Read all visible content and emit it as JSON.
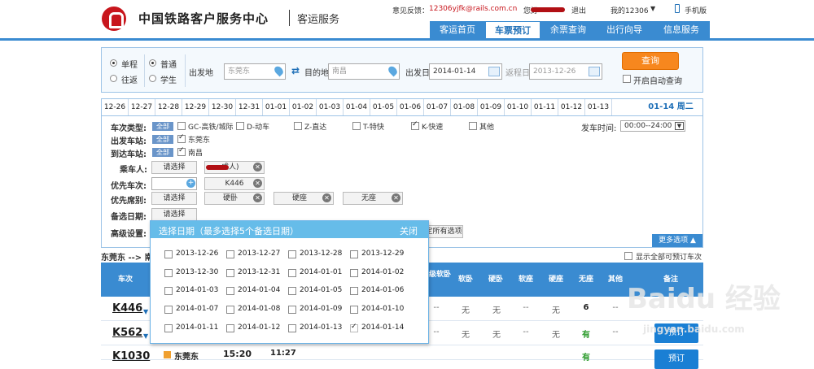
{
  "header": {
    "site_title": "中国铁路客户服务中心",
    "site_subtitle": "客运服务",
    "feedback_label": "意见反馈：",
    "feedback_email": "12306yjfk@rails.com.cn",
    "greeting": "您好",
    "logout": "退出",
    "my12306": "我的12306",
    "mobile": "手机版"
  },
  "nav": {
    "items": [
      "客运首页",
      "车票预订",
      "余票查询",
      "出行向导",
      "信息服务"
    ],
    "active_index": 1
  },
  "search": {
    "trip_oneway": "单程",
    "trip_return": "往返",
    "type_normal": "普通",
    "type_student": "学生",
    "from_label": "出发地",
    "from_value": "东莞东",
    "to_label": "目的地",
    "to_value": "南昌",
    "date_label": "出发日",
    "date_value": "2014-01-14",
    "return_label": "返程日",
    "return_value": "2013-12-26",
    "query_button": "查询",
    "auto_query": "开启自动查询"
  },
  "date_tabs": [
    "12-26",
    "12-27",
    "12-28",
    "12-29",
    "12-30",
    "12-31",
    "01-01",
    "01-02",
    "01-03",
    "01-04",
    "01-05",
    "01-06",
    "01-07",
    "01-08",
    "01-09",
    "01-10",
    "01-11",
    "01-12",
    "01-13"
  ],
  "date_current": "01-14 周二",
  "filters": {
    "train_type_label": "车次类型:",
    "all": "全部",
    "types": [
      {
        "label": "GC-高铁/城际",
        "checked": false
      },
      {
        "label": "D-动车",
        "checked": false
      },
      {
        "label": "Z-直达",
        "checked": false
      },
      {
        "label": "T-特快",
        "checked": false
      },
      {
        "label": "K-快速",
        "checked": true
      },
      {
        "label": "其他",
        "checked": false
      }
    ],
    "depart_time_label": "发车时间:",
    "depart_time_value": "00:00--24:00",
    "from_station_label": "出发车站:",
    "from_station": "东莞东",
    "to_station_label": "到达车站:",
    "to_station": "南昌",
    "passenger_label": "乘车人:",
    "select_button": "请选择",
    "passenger_value": "成人)",
    "prefer_train_label": "优先车次:",
    "prefer_train_value": "K446",
    "prefer_seat_label": "优先席别:",
    "seats": [
      "硬卧",
      "硬座",
      "无座"
    ],
    "backup_date_label": "备选日期:",
    "advanced_label": "高级设置:",
    "all_options_fragment": "定所有选项",
    "more_options": "更多选项"
  },
  "route": {
    "text": "东莞东 --> 南",
    "show_all_label": "显示全部可预订车次"
  },
  "table": {
    "headers": [
      "车次",
      "高级软卧",
      "软卧",
      "硬卧",
      "软座",
      "硬座",
      "无座",
      "其他",
      "备注"
    ],
    "rows": [
      {
        "train": "K446",
        "cells": [
          "--",
          "无",
          "无",
          "--",
          "无",
          "6",
          "--"
        ],
        "book": "预订"
      },
      {
        "train": "K562",
        "cells": [
          "--",
          "无",
          "无",
          "--",
          "无",
          "有",
          "--"
        ],
        "book": "预订"
      },
      {
        "train": "K1030",
        "station": "东莞东",
        "depart": "15:20",
        "arrive": "11:27",
        "cells": [
          "--",
          "--",
          "--",
          "--",
          "--",
          "有",
          "--"
        ],
        "book": "预订"
      }
    ]
  },
  "popup": {
    "title": "选择日期（最多选择5个备选日期）",
    "close": "关闭",
    "dates": [
      "2013-12-26",
      "2013-12-27",
      "2013-12-28",
      "2013-12-29",
      "2013-12-30",
      "2013-12-31",
      "2014-01-01",
      "2014-01-02",
      "2014-01-03",
      "2014-01-04",
      "2014-01-05",
      "2014-01-06",
      "2014-01-07",
      "2014-01-08",
      "2014-01-09",
      "2014-01-10",
      "2014-01-11",
      "2014-01-12",
      "2014-01-13",
      "2014-01-14"
    ]
  },
  "watermark": {
    "text": "Baidu 经验",
    "url": "jingyan.baidu.com"
  }
}
